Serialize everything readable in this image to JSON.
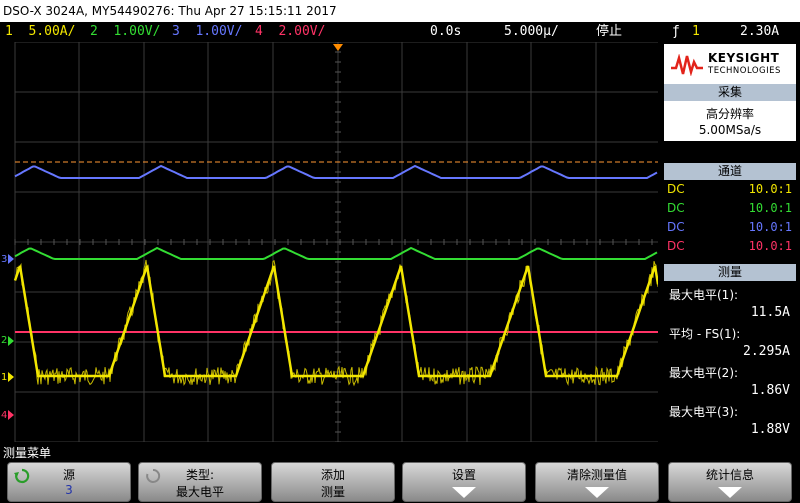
{
  "title": "DSO-X 3024A, MY54490276: Thu Apr 27 15:15:11 2017",
  "status": {
    "ch1": {
      "num": "1",
      "scale": "5.00A/",
      "color": "#f2e600"
    },
    "ch2": {
      "num": "2",
      "scale": "1.00V/",
      "color": "#33dd33"
    },
    "ch3": {
      "num": "3",
      "scale": "1.00V/",
      "color": "#6677ff"
    },
    "ch4": {
      "num": "4",
      "scale": "2.00V/",
      "color": "#ff3366"
    },
    "delay": "0.0s",
    "timebase": "5.000µ/",
    "run_state": "停止",
    "trigger_symbol": "ƒ",
    "trigger_channel": "1",
    "trigger_level": "2.30A"
  },
  "logo": {
    "brand": "KEYSIGHT",
    "sub": "TECHNOLOGIES"
  },
  "acquisition": {
    "header": "采集",
    "mode": "高分辨率",
    "rate": "5.00MSa/s"
  },
  "channels": {
    "header": "通道",
    "rows": [
      {
        "coupling": "DC",
        "probe": "10.0:1",
        "color": "#f2e600"
      },
      {
        "coupling": "DC",
        "probe": "10.0:1",
        "color": "#33dd33"
      },
      {
        "coupling": "DC",
        "probe": "10.0:1",
        "color": "#6677ff"
      },
      {
        "coupling": "DC",
        "probe": "10.0:1",
        "color": "#ff3366"
      }
    ]
  },
  "measurements": {
    "header": "测量",
    "items": [
      {
        "label": "最大电平(1):",
        "value": "11.5A"
      },
      {
        "label": "平均 - FS(1):",
        "value": "2.295A"
      },
      {
        "label": "最大电平(2):",
        "value": "1.86V"
      },
      {
        "label": "最大电平(3):",
        "value": "1.88V"
      }
    ]
  },
  "ground_markers": {
    "ch1": "1",
    "ch2": "2",
    "ch3": "3",
    "ch4": "4"
  },
  "menu": {
    "title": "测量菜单",
    "keys": [
      {
        "line1": "源",
        "line2": "3"
      },
      {
        "line1": "类型:",
        "line2": "最大电平"
      },
      {
        "line1": "添加",
        "line2": "测量"
      },
      {
        "line1": "设置",
        "line2": ""
      },
      {
        "line1": "清除测量值",
        "line2": ""
      },
      {
        "line1": "统计信息",
        "line2": ""
      }
    ]
  }
}
